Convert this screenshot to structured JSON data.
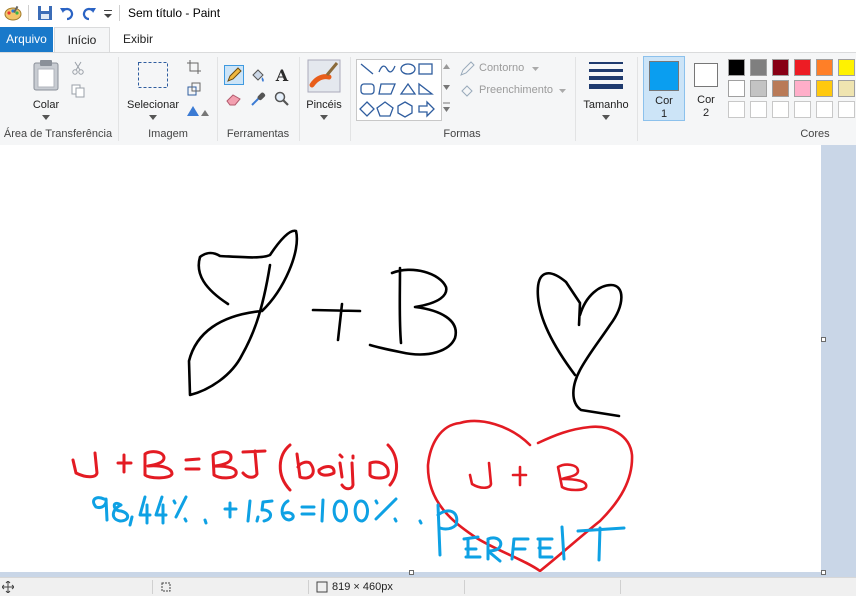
{
  "window": {
    "title": "Sem título - Paint"
  },
  "tabs": [
    {
      "label": "Arquivo"
    },
    {
      "label": "Início"
    },
    {
      "label": "Exibir"
    }
  ],
  "ribbon": {
    "clipboard": {
      "group_label": "Área de Transferência",
      "paste_label": "Colar"
    },
    "image": {
      "group_label": "Imagem",
      "select_label": "Selecionar"
    },
    "tools": {
      "group_label": "Ferramentas"
    },
    "brushes": {
      "label": "Pincéis"
    },
    "shapes": {
      "group_label": "Formas",
      "outline_label": "Contorno",
      "fill_label": "Preenchimento"
    },
    "size": {
      "label": "Tamanho"
    },
    "color1": {
      "label_line1": "Cor",
      "label_line2": "1",
      "value": "#0a9ef0"
    },
    "color2": {
      "label_line1": "Cor",
      "label_line2": "2",
      "value": "#ffffff"
    },
    "colors": {
      "group_label": "Cores",
      "row1": [
        "#000000",
        "#7f7f7f",
        "#880015",
        "#ed1c24",
        "#ff7f27",
        "#fff200"
      ],
      "row2": [
        "#ffffff",
        "#c3c3c3",
        "#b97a57",
        "#ffaec9",
        "#ffc90e",
        "#efe4b0"
      ],
      "row3": [
        "#ffffff",
        "#ffffff",
        "#ffffff",
        "#ffffff",
        "#ffffff",
        "#ffffff"
      ]
    }
  },
  "drawing": {
    "text_red": "J + B = BJ (beijo)",
    "text_blue": "98,44% + 1,56 = 100% PERFEIT",
    "heart_text": "J + B",
    "black_text": "J + B"
  },
  "status": {
    "canvas_size": "819 × 460px"
  }
}
